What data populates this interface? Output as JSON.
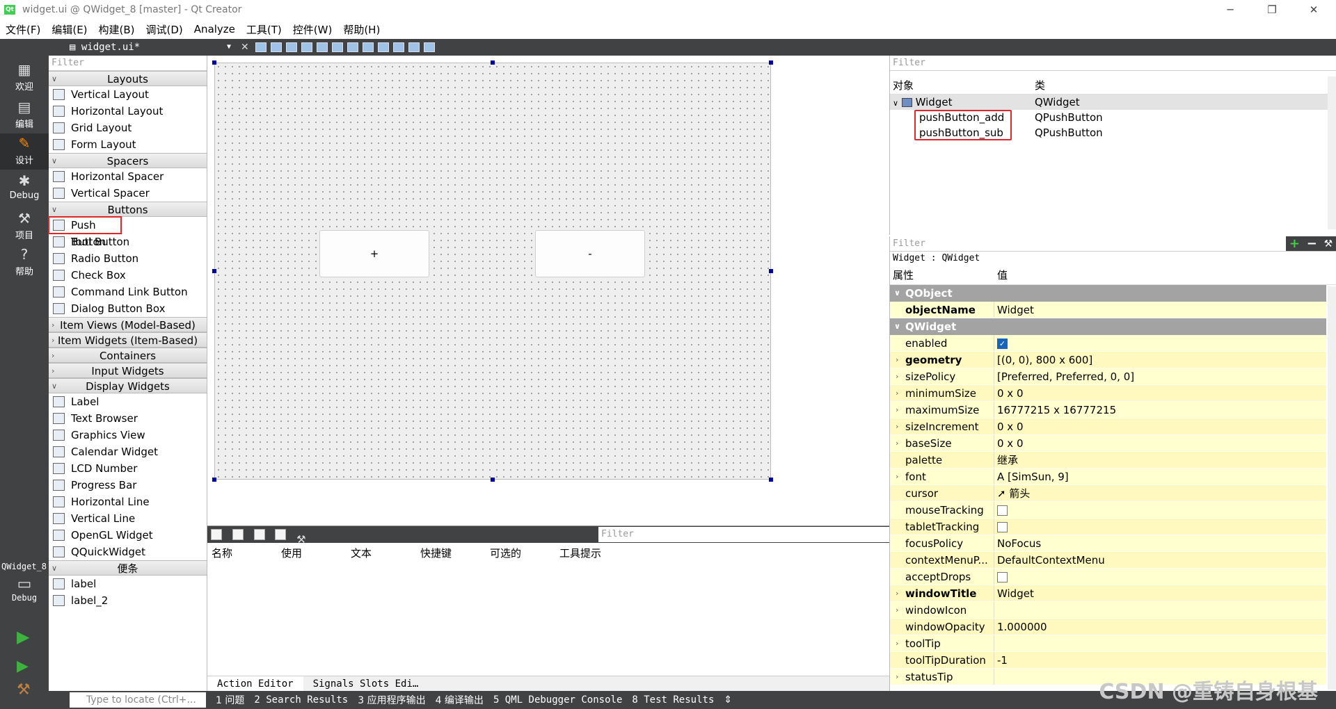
{
  "window": {
    "title": "widget.ui @ QWidget_8 [master] - Qt Creator",
    "qt_badge": "Qt"
  },
  "menu": [
    "文件(F)",
    "编辑(E)",
    "构建(B)",
    "调试(D)",
    "Analyze",
    "工具(T)",
    "控件(W)",
    "帮助(H)"
  ],
  "modes": [
    {
      "label": "欢迎",
      "icon": "welcome-grid-icon",
      "glyph": "▦"
    },
    {
      "label": "编辑",
      "icon": "edit-document-icon",
      "glyph": "▤"
    },
    {
      "label": "设计",
      "icon": "design-pencil-icon",
      "glyph": "✎",
      "active": true
    },
    {
      "label": "Debug",
      "icon": "debug-bug-icon",
      "glyph": "✱"
    },
    {
      "label": "项目",
      "icon": "project-wrench-icon",
      "glyph": "⚒"
    },
    {
      "label": "帮助",
      "icon": "help-icon",
      "glyph": "?"
    }
  ],
  "kit": {
    "project": "QWidget_8",
    "config": "Debug"
  },
  "editor_tab": {
    "file": "widget.ui*"
  },
  "widgetbox": {
    "filter_placeholder": "Filter",
    "categories": [
      {
        "name": "Layouts",
        "expanded": true,
        "items": [
          "Vertical Layout",
          "Horizontal Layout",
          "Grid Layout",
          "Form Layout"
        ]
      },
      {
        "name": "Spacers",
        "expanded": true,
        "items": [
          "Horizontal Spacer",
          "Vertical Spacer"
        ]
      },
      {
        "name": "Buttons",
        "expanded": true,
        "items": [
          "Push Button",
          "Tool Button",
          "Radio Button",
          "Check Box",
          "Command Link Button",
          "Dialog Button Box"
        ]
      },
      {
        "name": "Item Views (Model-Based)",
        "expanded": false,
        "items": []
      },
      {
        "name": "Item Widgets (Item-Based)",
        "expanded": false,
        "items": []
      },
      {
        "name": "Containers",
        "expanded": false,
        "items": []
      },
      {
        "name": "Input Widgets",
        "expanded": false,
        "items": []
      },
      {
        "name": "Display Widgets",
        "expanded": true,
        "items": [
          "Label",
          "Text Browser",
          "Graphics View",
          "Calendar Widget",
          "LCD Number",
          "Progress Bar",
          "Horizontal Line",
          "Vertical Line",
          "OpenGL Widget",
          "QQuickWidget"
        ]
      },
      {
        "name": "便条",
        "expanded": true,
        "items": [
          "label",
          "label_2"
        ]
      }
    ],
    "highlighted_item": "Push Button"
  },
  "form": {
    "buttons": [
      "+",
      "-"
    ]
  },
  "action_editor": {
    "filter_placeholder": "Filter",
    "columns": [
      "名称",
      "使用",
      "文本",
      "快捷键",
      "可选的",
      "工具提示"
    ],
    "tabs": [
      "Action Editor",
      "Signals Slots Edi…"
    ]
  },
  "object_inspector": {
    "filter_placeholder": "Filter",
    "columns": [
      "对象",
      "类"
    ],
    "rows": [
      {
        "object": "Widget",
        "class": "QWidget"
      },
      {
        "object": "pushButton_add",
        "class": "QPushButton"
      },
      {
        "object": "pushButton_sub",
        "class": "QPushButton"
      }
    ]
  },
  "property_editor": {
    "filter_placeholder": "Filter",
    "context": "Widget : QWidget",
    "columns": [
      "属性",
      "值"
    ],
    "groups": [
      {
        "name": "QObject",
        "props": [
          {
            "name": "objectName",
            "value": "Widget",
            "bold": true
          }
        ]
      },
      {
        "name": "QWidget",
        "props": [
          {
            "name": "enabled",
            "value": "",
            "check": "on"
          },
          {
            "name": "geometry",
            "value": "[(0, 0), 800 x 600]",
            "bold": true,
            "exp": true
          },
          {
            "name": "sizePolicy",
            "value": "[Preferred, Preferred, 0, 0]",
            "exp": true
          },
          {
            "name": "minimumSize",
            "value": "0 x 0",
            "exp": true
          },
          {
            "name": "maximumSize",
            "value": "16777215 x 16777215",
            "exp": true
          },
          {
            "name": "sizeIncrement",
            "value": "0 x 0",
            "exp": true
          },
          {
            "name": "baseSize",
            "value": "0 x 0",
            "exp": true
          },
          {
            "name": "palette",
            "value": "继承"
          },
          {
            "name": "font",
            "value": "[SimSun, 9]",
            "exp": true,
            "prefix": "A"
          },
          {
            "name": "cursor",
            "value": "箭头",
            "prefix": "➚"
          },
          {
            "name": "mouseTracking",
            "value": "",
            "check": "off"
          },
          {
            "name": "tabletTracking",
            "value": "",
            "check": "off"
          },
          {
            "name": "focusPolicy",
            "value": "NoFocus"
          },
          {
            "name": "contextMenuP...",
            "value": "DefaultContextMenu"
          },
          {
            "name": "acceptDrops",
            "value": "",
            "check": "off"
          },
          {
            "name": "windowTitle",
            "value": "Widget",
            "bold": true,
            "exp": true
          },
          {
            "name": "windowIcon",
            "value": "",
            "exp": true
          },
          {
            "name": "windowOpacity",
            "value": "1.000000"
          },
          {
            "name": "toolTip",
            "value": "",
            "exp": true
          },
          {
            "name": "toolTipDuration",
            "value": "-1"
          },
          {
            "name": "statusTip",
            "value": "",
            "exp": true
          }
        ]
      }
    ]
  },
  "statusbar": {
    "locator_placeholder": "Type to locate (Ctrl+...",
    "panes": [
      "1 问题",
      "2 Search Results",
      "3 应用程序输出",
      "4 编译输出",
      "5 QML Debugger Console",
      "8 Test Results"
    ]
  },
  "watermark": "CSDN @重铸自身根基",
  "colors": {
    "accent_red": "#e0262b",
    "dark_bar": "#404244",
    "prop_yellow": "#ffffd0",
    "group_grey": "#a3a3a3"
  }
}
